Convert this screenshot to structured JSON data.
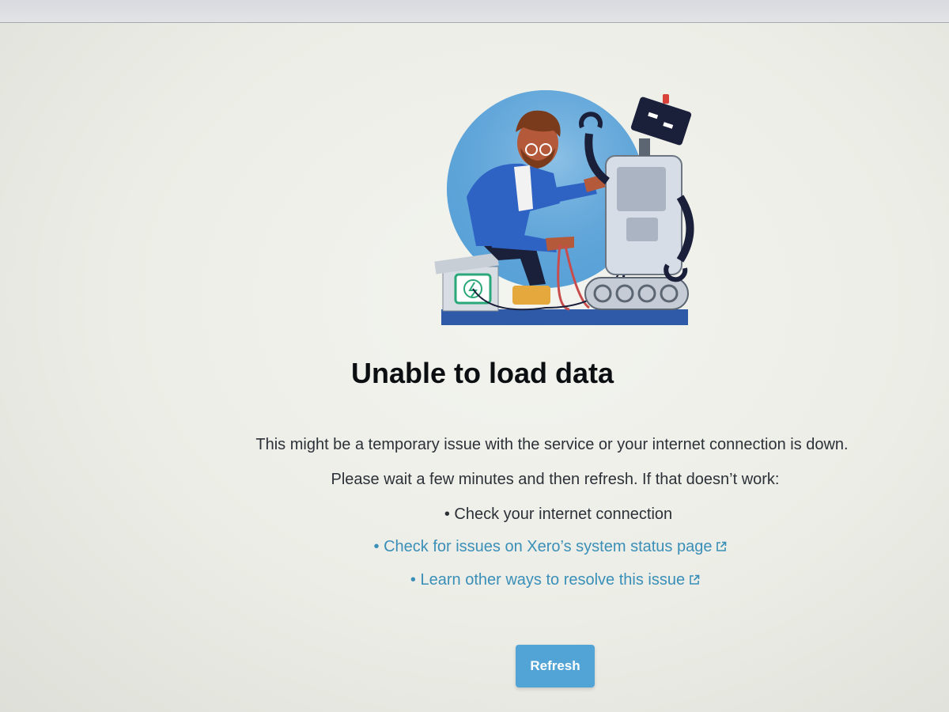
{
  "error": {
    "title": "Unable to load data",
    "message_line1": "This might be a temporary issue with the service or your internet connection is down.",
    "message_line2": "Please wait a few minutes and then refresh. If that doesn’t work:"
  },
  "suggestions": [
    {
      "text": "Check your internet connection",
      "is_link": false
    },
    {
      "text": "Check for issues on Xero’s system status page",
      "is_link": true,
      "icon": "external-link-icon"
    },
    {
      "text": "Learn other ways to resolve this issue",
      "is_link": true,
      "icon": "external-link-icon"
    }
  ],
  "bullet_char": "•",
  "actions": {
    "refresh_label": "Refresh"
  },
  "colors": {
    "accent": "#52a4d6",
    "link": "#3a8fb8",
    "title": "#0c0f12",
    "body_text": "#2c3138"
  },
  "illustration": {
    "icon": "person-repairing-robot-illustration",
    "battery_symbol": "ϟ"
  }
}
